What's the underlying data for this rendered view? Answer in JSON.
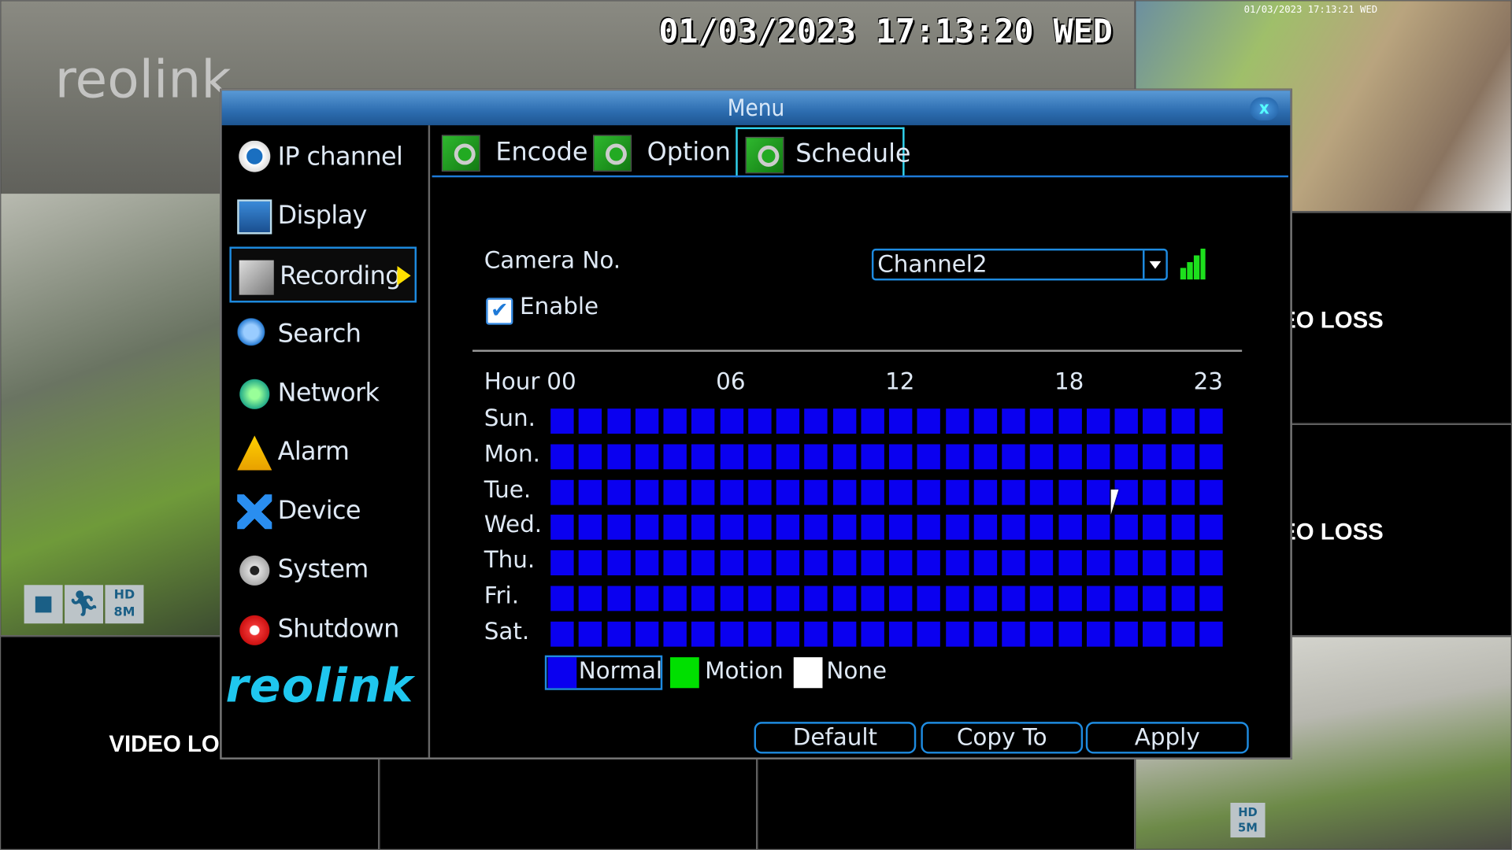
{
  "overlay": {
    "datetime": "01/03/2023 17:13:20 WED",
    "small_datetime": "01/03/2023 17:13:21 WED",
    "watermark": "reolink",
    "cam_badge_top": "HD 8M",
    "cam_badge_bottom": "HD 5M"
  },
  "tiles": {
    "video_loss": "VIDEO LOSS"
  },
  "menu": {
    "title": "Menu",
    "close_label": "x",
    "sidebar": {
      "items": [
        {
          "label": "IP channel",
          "icon": "ip-camera-icon"
        },
        {
          "label": "Display",
          "icon": "display-icon"
        },
        {
          "label": "Recording",
          "icon": "recording-icon",
          "active": true
        },
        {
          "label": "Search",
          "icon": "search-icon"
        },
        {
          "label": "Network",
          "icon": "network-icon"
        },
        {
          "label": "Alarm",
          "icon": "alarm-icon"
        },
        {
          "label": "Device",
          "icon": "device-icon"
        },
        {
          "label": "System",
          "icon": "gear-icon"
        },
        {
          "label": "Shutdown",
          "icon": "power-icon"
        }
      ],
      "logo": "reolink"
    },
    "tabs": [
      {
        "label": "Encode"
      },
      {
        "label": "Option"
      },
      {
        "label": "Schedule",
        "active": true
      }
    ],
    "schedule": {
      "camera_label": "Camera No.",
      "camera_value": "Channel2",
      "enable_label": "Enable",
      "enabled": true,
      "hour_label": "Hour",
      "hour_ticks": [
        "00",
        "06",
        "12",
        "18",
        "23"
      ],
      "days": [
        {
          "label": "Sun.",
          "mode": "Normal"
        },
        {
          "label": "Mon.",
          "mode": "Normal"
        },
        {
          "label": "Tue.",
          "mode": "Normal"
        },
        {
          "label": "Wed.",
          "mode": "Normal"
        },
        {
          "label": "Thu.",
          "mode": "Normal"
        },
        {
          "label": "Fri.",
          "mode": "Normal"
        },
        {
          "label": "Sat.",
          "mode": "Normal"
        }
      ],
      "legend": [
        {
          "label": "Normal",
          "color": "#0a00f0",
          "selected": true
        },
        {
          "label": "Motion",
          "color": "#00e000"
        },
        {
          "label": "None",
          "color": "#ffffff"
        }
      ],
      "buttons": {
        "default": "Default",
        "copy_to": "Copy To",
        "apply": "Apply"
      }
    }
  }
}
